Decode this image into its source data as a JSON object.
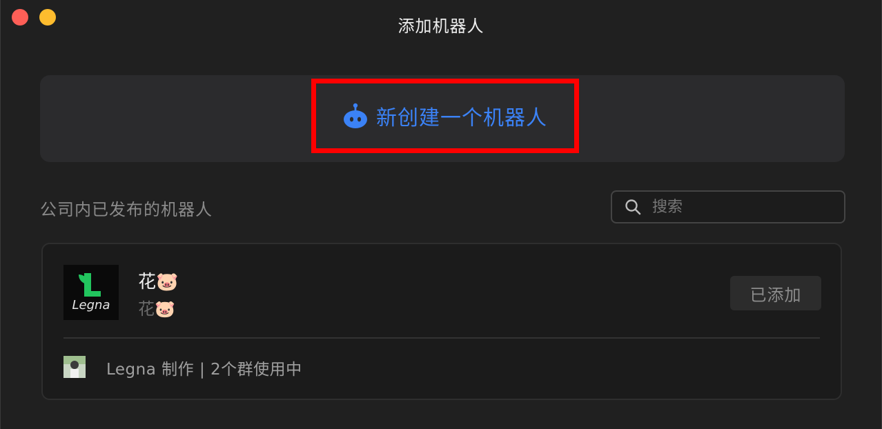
{
  "window": {
    "title": "添加机器人"
  },
  "create": {
    "label": "新创建一个机器人",
    "accent": "#3b82f6",
    "highlight": "#ff0000",
    "icon": "robot-icon"
  },
  "section": {
    "title": "公司内已发布的机器人"
  },
  "search": {
    "placeholder": "搜索",
    "value": "",
    "icon": "search-icon"
  },
  "bots": [
    {
      "name": "花🐷",
      "description": "花🐷",
      "logo_text": "Legna",
      "status_label": "已添加",
      "meta": "Legna 制作 | 2个群使用中"
    }
  ]
}
